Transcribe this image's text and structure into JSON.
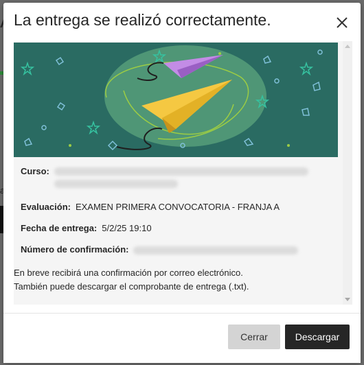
{
  "modal": {
    "title": "La entrega se realizó correctamente."
  },
  "details": {
    "course_label": "Curso:",
    "evaluation_label": "Evaluación:",
    "evaluation_value": "EXAMEN PRIMERA CONVOCATORIA - FRANJA A",
    "date_label": "Fecha de entrega:",
    "date_value": "5/2/25 19:10",
    "confirmation_label": "Número de confirmación:"
  },
  "message": {
    "line1": "En breve recibirá una confirmación por correo electrónico.",
    "line2": "También puede descargar el comprobante de entrega (.txt)."
  },
  "footer": {
    "close_label": "Cerrar",
    "download_label": "Descargar"
  },
  "icons": [
    "close-icon",
    "paper-plane-icon",
    "scroll-up-icon",
    "scroll-down-icon"
  ],
  "colors": {
    "banner_bg": "#2a6b62",
    "plane_yellow": "#f5c842",
    "plane_purple": "#c38ce6",
    "primary_button": "#262626",
    "secondary_button": "#d4d4d4"
  }
}
